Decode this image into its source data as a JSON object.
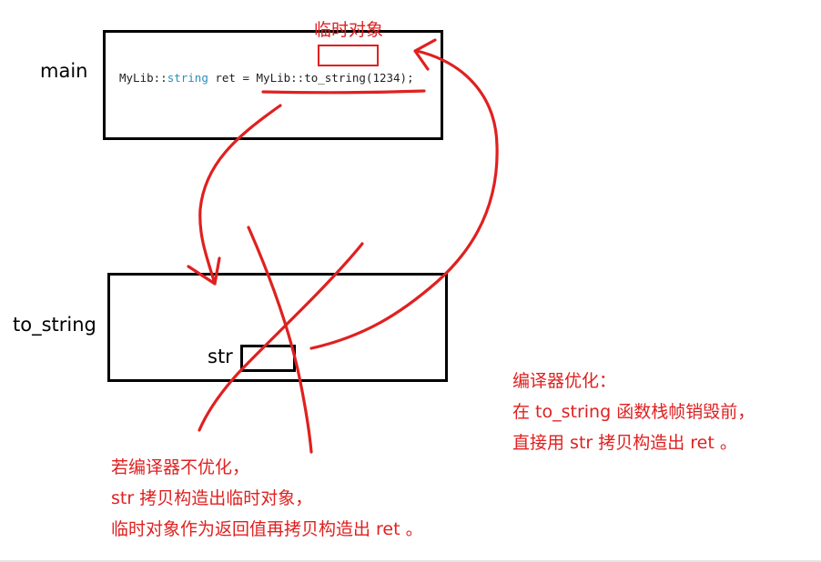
{
  "labels": {
    "main": "main",
    "to_string": "to_string",
    "str": "str",
    "temp_object": "临时对象"
  },
  "code": {
    "ns": "MyLib::",
    "type": "string",
    "rest": " ret = MyLib::to_string(1234);"
  },
  "note_no_opt": [
    "若编译器不优化，",
    "str 拷贝构造出临时对象，",
    "临时对象作为返回值再拷贝构造出 ret 。"
  ],
  "note_opt": [
    "编译器优化：",
    "在 to_string 函数栈帧销毁前，",
    "直接用 str 拷贝构造出 ret 。"
  ],
  "colors": {
    "annotation": "#e02020",
    "keyword": "#2b8fb8",
    "frame": "#000000"
  }
}
